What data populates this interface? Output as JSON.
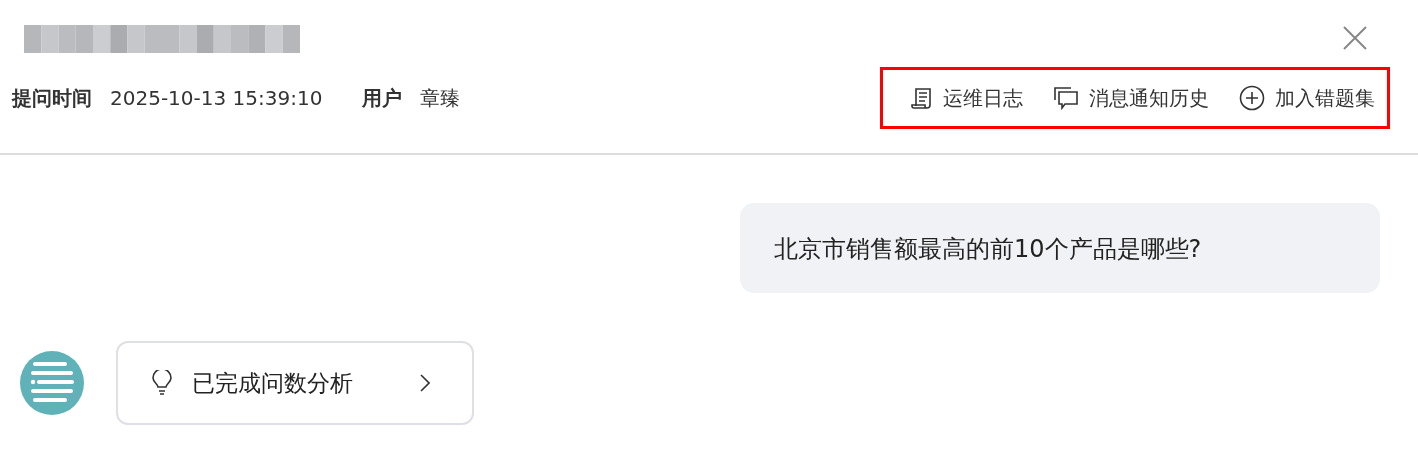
{
  "meta": {
    "question_time_label": "提问时间",
    "question_time": "2025-10-13 15:39:10",
    "user_label": "用户",
    "user": "章臻"
  },
  "actions": [
    {
      "kind": "log",
      "label": "运维日志"
    },
    {
      "kind": "messages",
      "label": "消息通知历史"
    },
    {
      "kind": "add",
      "label": "加入错题集"
    }
  ],
  "question": "北京市销售额最高的前10个产品是哪些?",
  "analysis_step": {
    "label": "已完成问数分析"
  }
}
